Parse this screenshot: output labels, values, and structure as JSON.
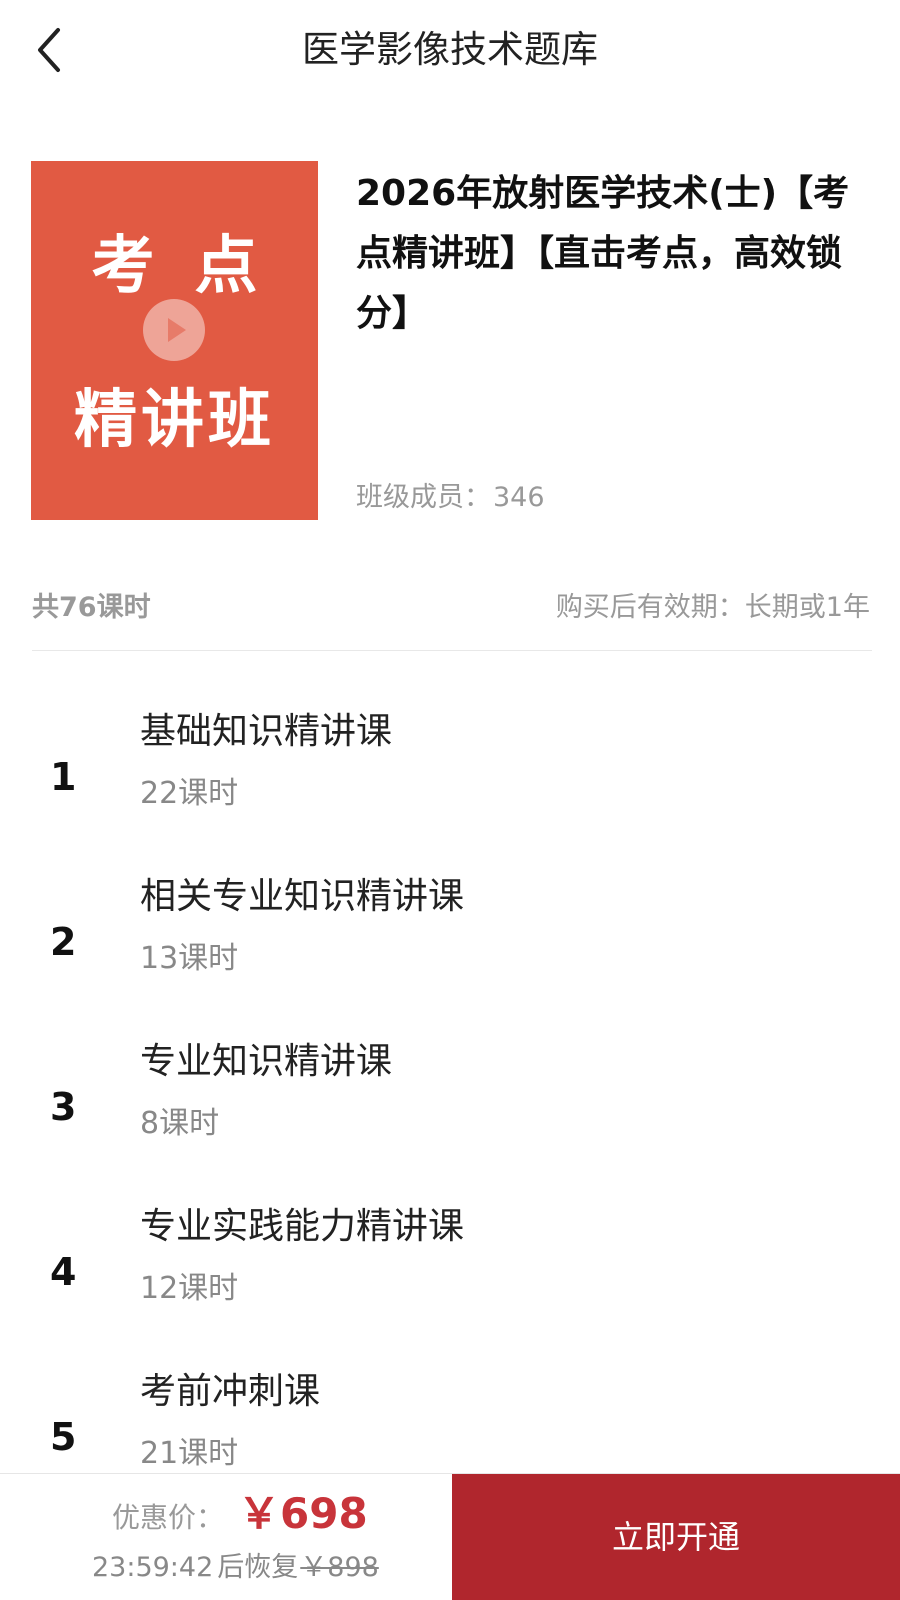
{
  "header": {
    "title": "医学影像技术题库"
  },
  "course": {
    "cover": {
      "line1": "考点",
      "line2": "精讲班",
      "bg_color": "#e15a43"
    },
    "title": "2026年放射医学技术(士)【考点精讲班】【直击考点，高效锁分】",
    "members_label": "班级成员：",
    "members_count": "346"
  },
  "summary": {
    "total": "共76课时",
    "validity": "购买后有效期：长期或1年"
  },
  "lessons": [
    {
      "index": "1",
      "name": "基础知识精讲课",
      "count": "22课时"
    },
    {
      "index": "2",
      "name": "相关专业知识精讲课",
      "count": "13课时"
    },
    {
      "index": "3",
      "name": "专业知识精讲课",
      "count": "8课时"
    },
    {
      "index": "4",
      "name": "专业实践能力精讲课",
      "count": "12课时"
    },
    {
      "index": "5",
      "name": "考前冲刺课",
      "count": "21课时"
    }
  ],
  "purchase": {
    "price_label": "优惠价：",
    "price": "￥698",
    "countdown": "23:59:42",
    "countdown_text": "后恢复",
    "original_price": "￥898",
    "buy_label": "立即开通",
    "accent_color": "#b0262d"
  },
  "icons": {
    "back": "chevron-left-icon",
    "play": "play-icon"
  }
}
